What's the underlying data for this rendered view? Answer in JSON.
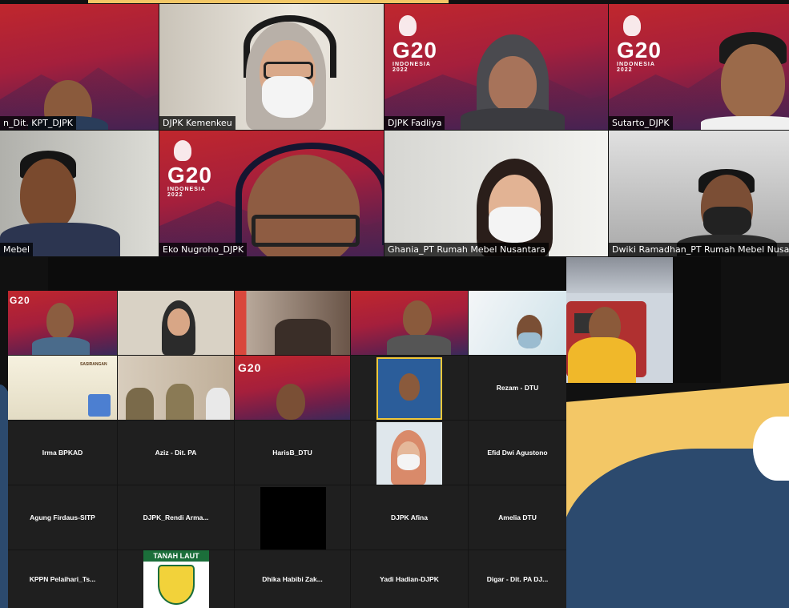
{
  "top_grid": {
    "row1": [
      {
        "name": "n_Dit. KPT_DJPK"
      },
      {
        "name": "DJPK Kemenkeu"
      },
      {
        "name": "DJPK Fadliya"
      },
      {
        "name": "Sutarto_DJPK"
      }
    ],
    "row2": [
      {
        "name": "Mebel"
      },
      {
        "name": "Eko Nugroho_DJPK"
      },
      {
        "name": "Ghania_PT Rumah Mebel Nusantara"
      },
      {
        "name": "Dwiki Ramadhan_PT Rumah Mebel Nusantara"
      }
    ]
  },
  "g20": {
    "title": "G20",
    "sub1": "INDONESIA",
    "sub2": "2022"
  },
  "bottom_grid": {
    "text_cells": {
      "rezam": "Rezam - DTU",
      "irma": "Irma BPKAD",
      "aziz": "Aziz - Dit. PA",
      "haris": "HarisB_DTU",
      "efid": "Efid Dwi Agustono",
      "agung": "Agung Firdaus-SITP",
      "rendi": "DJPK_Rendi  Arma...",
      "afina": "DJPK Afina",
      "amelia": "Amelia DTU",
      "kppn": "KPPN  Pelaihari_Ts...",
      "dhika": "Dhika  Habibi Zak...",
      "yadi": "Yadi Hadian-DJPK",
      "digar": "Digar - Dit. PA DJ..."
    },
    "slide_title": "SASIRANGAN",
    "tanah_laut": "TANAH  LAUT"
  },
  "colors": {
    "accent_yellow": "#f3c766",
    "accent_blue": "#2c4a6e",
    "g20_red": "#c0272d"
  }
}
